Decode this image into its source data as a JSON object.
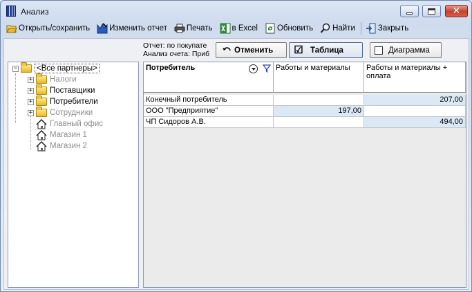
{
  "window": {
    "title": "Анализ"
  },
  "toolbar": {
    "open_save": "Открыть/сохранить",
    "edit_report": "Изменить отчет",
    "print": "Печать",
    "to_excel": "в Excel",
    "refresh": "Обновить",
    "find": "Найти",
    "close": "Закрыть"
  },
  "report": {
    "line1": "Отчет:  по покупате",
    "line2": "Анализ счета:  Приб"
  },
  "controls": {
    "cancel": "Отменить",
    "table": "Таблица",
    "table_checked": "☑",
    "chart": "Диаграмма",
    "chart_checked": ""
  },
  "tree": {
    "root": "<Все партнеры>",
    "items": [
      {
        "label": "Налоги",
        "type": "folder",
        "disabled": true
      },
      {
        "label": "Поставщики",
        "type": "folder",
        "disabled": false
      },
      {
        "label": "Потребители",
        "type": "folder",
        "disabled": false
      },
      {
        "label": "Сотрудники",
        "type": "folder",
        "disabled": true
      },
      {
        "label": "Главный офис",
        "type": "house",
        "disabled": true
      },
      {
        "label": "Магазин 1",
        "type": "house",
        "disabled": true
      },
      {
        "label": "Магазин 2",
        "type": "house",
        "disabled": true
      }
    ]
  },
  "grid": {
    "columns": [
      "Потребитель",
      "Работы и материалы",
      "Работы и материалы + оплата"
    ],
    "rows": [
      {
        "name": "Конечный потребитель",
        "col1": "",
        "col2": "207,00"
      },
      {
        "name": "ООО \"Предприятие\"",
        "col1": "197,00",
        "col2": ""
      },
      {
        "name": "ЧП Сидоров А.В.",
        "col1": "",
        "col2": "494,00"
      }
    ]
  },
  "colors": {
    "highlight_cell": "#dbe9f7",
    "window_bg": "#dfe8f4"
  }
}
